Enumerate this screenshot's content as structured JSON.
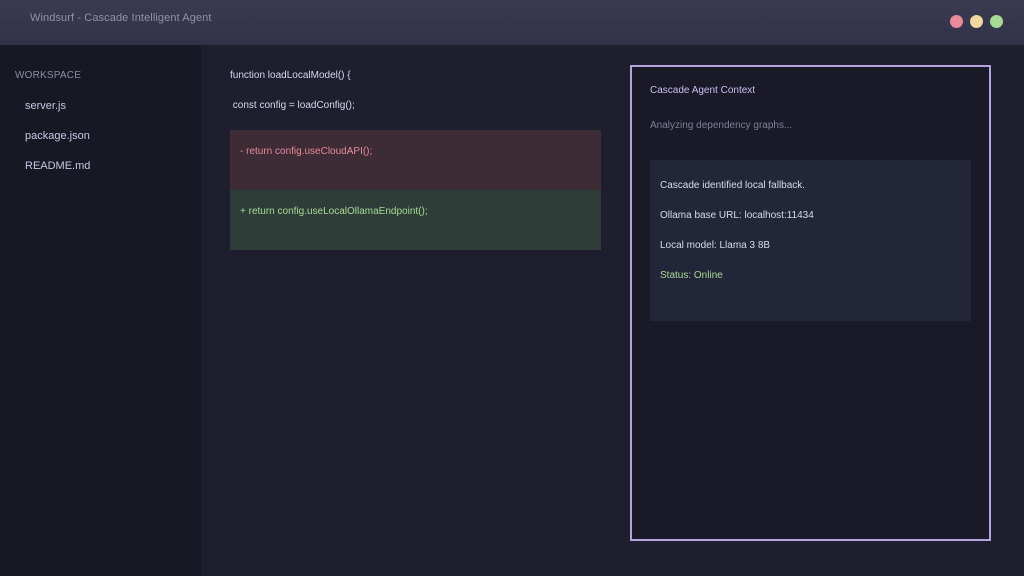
{
  "window": {
    "title": "Windsurf - Cascade Intelligent Agent",
    "controls": [
      {
        "name": "close",
        "color": "#e8899c"
      },
      {
        "name": "minimize",
        "color": "#f3d7a0"
      },
      {
        "name": "maximize",
        "color": "#a6da95"
      }
    ]
  },
  "sidebar": {
    "heading": "WORKSPACE",
    "items": [
      {
        "label": "server.js"
      },
      {
        "label": "package.json"
      },
      {
        "label": "README.md"
      }
    ]
  },
  "editor": {
    "lines": [
      "function loadLocalModel() {",
      " const config = loadConfig();"
    ],
    "diff": {
      "removed": {
        "text": "- return config.useCloudAPI();",
        "bg": "#3d2c35",
        "color": "#e8899c"
      },
      "added": {
        "text": "+ return config.useLocalOllamaEndpoint();",
        "bg": "#2e3d37",
        "color": "#a6da95"
      }
    }
  },
  "agent": {
    "title": "Cascade Agent Context",
    "status": "Analyzing dependency graphs...",
    "card": {
      "lines": [
        "Cascade identified local fallback.",
        "Ollama base URL: localhost:11434",
        "Local model: Llama 3 8B"
      ],
      "status_line": "Status: Online",
      "status_color": "#a6da95"
    },
    "accent_color": "#b5a3df"
  }
}
